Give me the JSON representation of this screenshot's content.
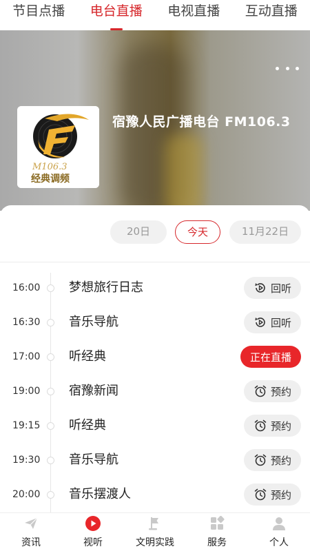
{
  "top_tabs": [
    {
      "label": "节目点播",
      "active": false
    },
    {
      "label": "电台直播",
      "active": true
    },
    {
      "label": "电视直播",
      "active": false
    },
    {
      "label": "互动直播",
      "active": false
    }
  ],
  "station": {
    "name": "宿豫人民广播电台 FM106.3",
    "logo_text_top": "M106.3",
    "logo_text_bottom": "经典调频"
  },
  "dates": {
    "prev": "20日",
    "today": "今天",
    "next": "11月22日"
  },
  "programs": [
    {
      "time": "16:00",
      "title": "梦想旅行日志",
      "action": "回听",
      "action_icon": "replay-icon",
      "status": "replay"
    },
    {
      "time": "16:30",
      "title": "音乐导航",
      "action": "回听",
      "action_icon": "replay-icon",
      "status": "replay"
    },
    {
      "time": "17:00",
      "title": "听经典",
      "action": "正在直播",
      "action_icon": "",
      "status": "live"
    },
    {
      "time": "19:00",
      "title": "宿豫新闻",
      "action": "预约",
      "action_icon": "alarm-clock-icon",
      "status": "reserve"
    },
    {
      "time": "19:15",
      "title": "听经典",
      "action": "预约",
      "action_icon": "alarm-clock-icon",
      "status": "reserve"
    },
    {
      "time": "19:30",
      "title": "音乐导航",
      "action": "预约",
      "action_icon": "alarm-clock-icon",
      "status": "reserve"
    },
    {
      "time": "20:00",
      "title": "音乐摆渡人",
      "action": "预约",
      "action_icon": "alarm-clock-icon",
      "status": "reserve"
    }
  ],
  "bottom_nav": [
    {
      "label": "资讯",
      "icon": "paper-plane-icon",
      "active": false
    },
    {
      "label": "视听",
      "icon": "play-circle-icon",
      "active": true
    },
    {
      "label": "文明实践",
      "icon": "flag-icon",
      "active": false
    },
    {
      "label": "服务",
      "icon": "grid-icon",
      "active": false
    },
    {
      "label": "个人",
      "icon": "person-icon",
      "active": false
    }
  ],
  "colors": {
    "accent": "#d6272b",
    "live_bg": "#e8262a",
    "chip_bg": "#efefef"
  }
}
